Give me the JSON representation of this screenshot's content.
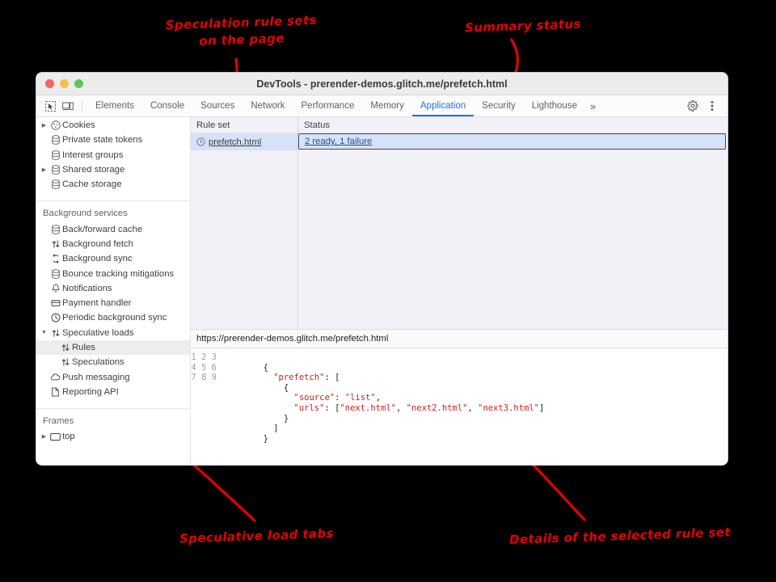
{
  "annotations": {
    "ruleset": "Speculation rule sets\non the page",
    "summary": "Summary status",
    "tabs": "Speculative load tabs",
    "details": "Details of the selected rule set"
  },
  "window": {
    "title": "DevTools - prerender-demos.glitch.me/prefetch.html"
  },
  "toolbar": {
    "icons": [
      "inspect-icon",
      "device-toolbar-icon"
    ],
    "tabs": [
      {
        "label": "Elements",
        "active": false
      },
      {
        "label": "Console",
        "active": false
      },
      {
        "label": "Sources",
        "active": false
      },
      {
        "label": "Network",
        "active": false
      },
      {
        "label": "Performance",
        "active": false
      },
      {
        "label": "Memory",
        "active": false
      },
      {
        "label": "Application",
        "active": true
      },
      {
        "label": "Security",
        "active": false
      },
      {
        "label": "Lighthouse",
        "active": false
      }
    ],
    "overflow_label": "»",
    "settings_icon": "gear-icon",
    "more_icon": "kebab-menu-icon"
  },
  "sidebar": {
    "storage_items": [
      {
        "label": "Cookies",
        "icon": "cookie-icon",
        "expandable": true,
        "expanded": false
      },
      {
        "label": "Private state tokens",
        "icon": "database-icon",
        "expandable": false
      },
      {
        "label": "Interest groups",
        "icon": "database-icon",
        "expandable": false
      },
      {
        "label": "Shared storage",
        "icon": "database-icon",
        "expandable": true,
        "expanded": false
      },
      {
        "label": "Cache storage",
        "icon": "database-icon",
        "expandable": false
      }
    ],
    "background_services_header": "Background services",
    "background_items": [
      {
        "label": "Back/forward cache",
        "icon": "database-icon",
        "expandable": false
      },
      {
        "label": "Background fetch",
        "icon": "updown-arrows-icon",
        "expandable": false
      },
      {
        "label": "Background sync",
        "icon": "sync-arrows-icon",
        "expandable": false
      },
      {
        "label": "Bounce tracking mitigations",
        "icon": "database-icon",
        "expandable": false
      },
      {
        "label": "Notifications",
        "icon": "bell-icon",
        "expandable": false
      },
      {
        "label": "Payment handler",
        "icon": "card-icon",
        "expandable": false
      },
      {
        "label": "Periodic background sync",
        "icon": "clock-icon",
        "expandable": false
      },
      {
        "label": "Speculative loads",
        "icon": "updown-arrows-icon",
        "expandable": true,
        "expanded": true
      }
    ],
    "speculative_children": [
      {
        "label": "Rules",
        "icon": "updown-arrows-icon",
        "selected": true
      },
      {
        "label": "Speculations",
        "icon": "updown-arrows-icon",
        "selected": false
      }
    ],
    "tail_items": [
      {
        "label": "Push messaging",
        "icon": "cloud-icon"
      },
      {
        "label": "Reporting API",
        "icon": "document-icon"
      }
    ],
    "frames_header": "Frames",
    "frames_items": [
      {
        "label": "top",
        "icon": "frame-icon",
        "expandable": true,
        "expanded": false
      }
    ]
  },
  "grid": {
    "col_ruleset_header": "Rule set",
    "col_status_header": "Status",
    "rows": [
      {
        "ruleset": "prefetch.html",
        "ruleset_icon": "clock-info-icon",
        "status": "2 ready, 1 failure",
        "selected": true
      }
    ]
  },
  "details": {
    "url": "https://prerender-demos.glitch.me/prefetch.html",
    "line_numbers": [
      "1",
      "2",
      "3",
      "4",
      "5",
      "6",
      "7",
      "8",
      "9"
    ],
    "code_lines": [
      "",
      "        {",
      "          \"prefetch\": [",
      "            {",
      "              \"source\": \"list\",",
      "              \"urls\": [\"next.html\", \"next2.html\", \"next3.html\"]",
      "            }",
      "          ]",
      "        }"
    ]
  },
  "colors": {
    "accent": "#1a73e8",
    "annotation": "#e60000",
    "row_selected": "#d6e2f7",
    "code_string": "#c5221f"
  }
}
